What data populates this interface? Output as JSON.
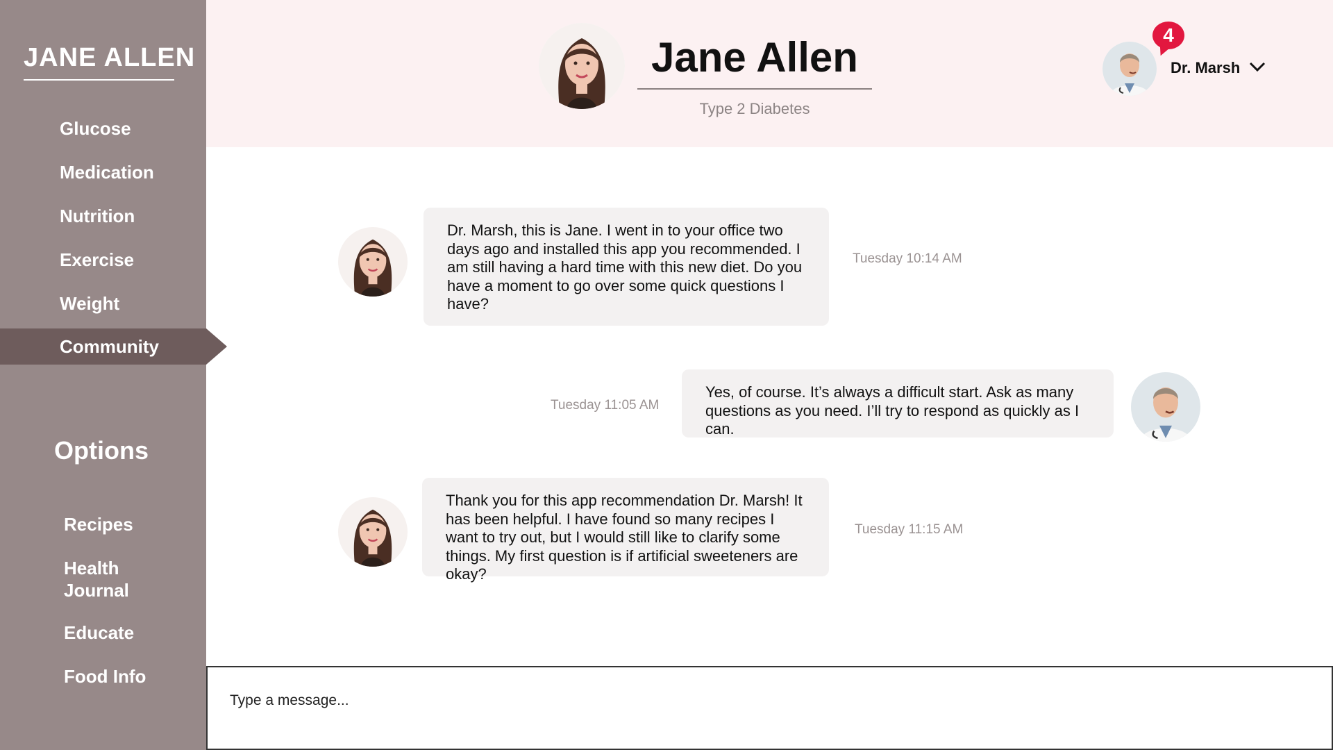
{
  "sidebar": {
    "brand": "JANE ALLEN",
    "nav_items": [
      {
        "label": "Glucose"
      },
      {
        "label": "Medication"
      },
      {
        "label": "Nutrition"
      },
      {
        "label": "Exercise"
      },
      {
        "label": "Weight"
      },
      {
        "label": "Community",
        "active": true
      }
    ],
    "options_title": "Options",
    "options": [
      {
        "label": "Recipes"
      },
      {
        "label": "Health Journal"
      },
      {
        "label": "Educate"
      },
      {
        "label": "Food Info"
      }
    ]
  },
  "header": {
    "patient_name": "Jane Allen",
    "condition": "Type 2 Diabetes",
    "doctor_name": "Dr. Marsh",
    "notification_count": "4"
  },
  "messages": [
    {
      "sender": "patient",
      "text": "Dr. Marsh, this is Jane. I went in to your office two days ago and installed this app you recommended. I am still having a hard time with this new diet. Do you have a moment to go over some quick questions I have?",
      "timestamp": "Tuesday 10:14 AM"
    },
    {
      "sender": "doctor",
      "text": "Yes, of course. It’s always a difficult start. Ask as many questions as you need. I’ll try to respond as quickly as I can.",
      "timestamp": "Tuesday 11:05 AM"
    },
    {
      "sender": "patient",
      "text": "Thank you for this app recommendation Dr. Marsh! It has been helpful. I have found so many recipes I want to try out, but I would still like to clarify some things. My first question is if artificial sweeteners are okay?",
      "timestamp": "Tuesday 11:15 AM"
    }
  ],
  "composer": {
    "placeholder": "Type a message..."
  },
  "colors": {
    "sidebar": "#978989",
    "sidebar_active": "#6e5c5c",
    "header_bg": "#fcf1f2",
    "bubble_bg": "#f3f1f1",
    "badge": "#e2173f"
  },
  "icons": {
    "patient_avatar": "woman-portrait-icon",
    "doctor_avatar": "doctor-portrait-icon",
    "dropdown": "chevron-down-icon"
  }
}
